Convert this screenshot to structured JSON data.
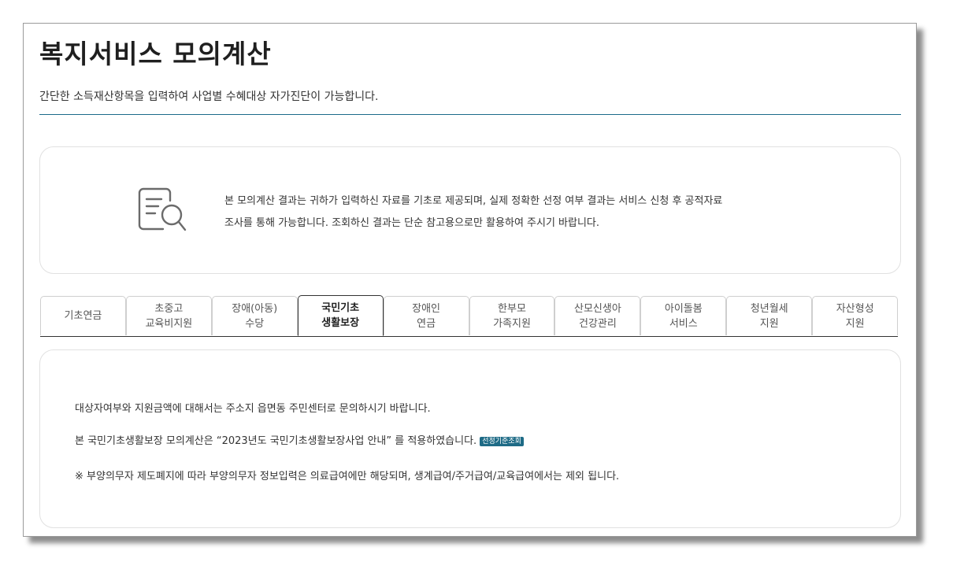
{
  "header": {
    "title": "복지서비스 모의계산",
    "subtitle": "간단한 소득재산항목을 입력하여 사업별 수혜대상 자가진단이 가능합니다."
  },
  "notice": {
    "icon": "document-search-icon",
    "line1": "본 모의계산 결과는 귀하가 입력하신 자료를 기초로 제공되며, 실제 정확한 선정 여부 결과는 서비스 신청 후 공적자료",
    "line2": "조사를 통해 가능합니다. 조회하신 결과는 단순 참고용으로만 활용하여 주시기 바랍니다."
  },
  "tabs": [
    {
      "line1": "기초연금",
      "line2": ""
    },
    {
      "line1": "초중고",
      "line2": "교육비지원"
    },
    {
      "line1": "장애(아동)",
      "line2": "수당"
    },
    {
      "line1": "국민기초",
      "line2": "생활보장"
    },
    {
      "line1": "장애인",
      "line2": "연금"
    },
    {
      "line1": "한부모",
      "line2": "가족지원"
    },
    {
      "line1": "산모신생아",
      "line2": "건강관리"
    },
    {
      "line1": "아이돌봄",
      "line2": "서비스"
    },
    {
      "line1": "청년월세",
      "line2": "지원"
    },
    {
      "line1": "자산형성",
      "line2": "지원"
    }
  ],
  "active_tab": "국민기초 생활보장",
  "info": {
    "line1": "대상자여부와 지원금액에 대해서는 주소지 읍면동 주민센터로 문의하시기 바랍니다.",
    "line2": "본 국민기초생활보장 모의계산은 “2023년도 국민기초생활보장사업 안내” 를 적용하였습니다.",
    "badge": "선정기준조회",
    "line3": "※ 부양의무자 제도폐지에 따라 부양의무자 정보입력은 의료급여에만 해당되며, 생계급여/주거급여/교육급여에서는 제외 됩니다."
  },
  "colors": {
    "accent": "#1c6a8a",
    "badge": "#1e6b86",
    "border": "#e1e1e1"
  }
}
